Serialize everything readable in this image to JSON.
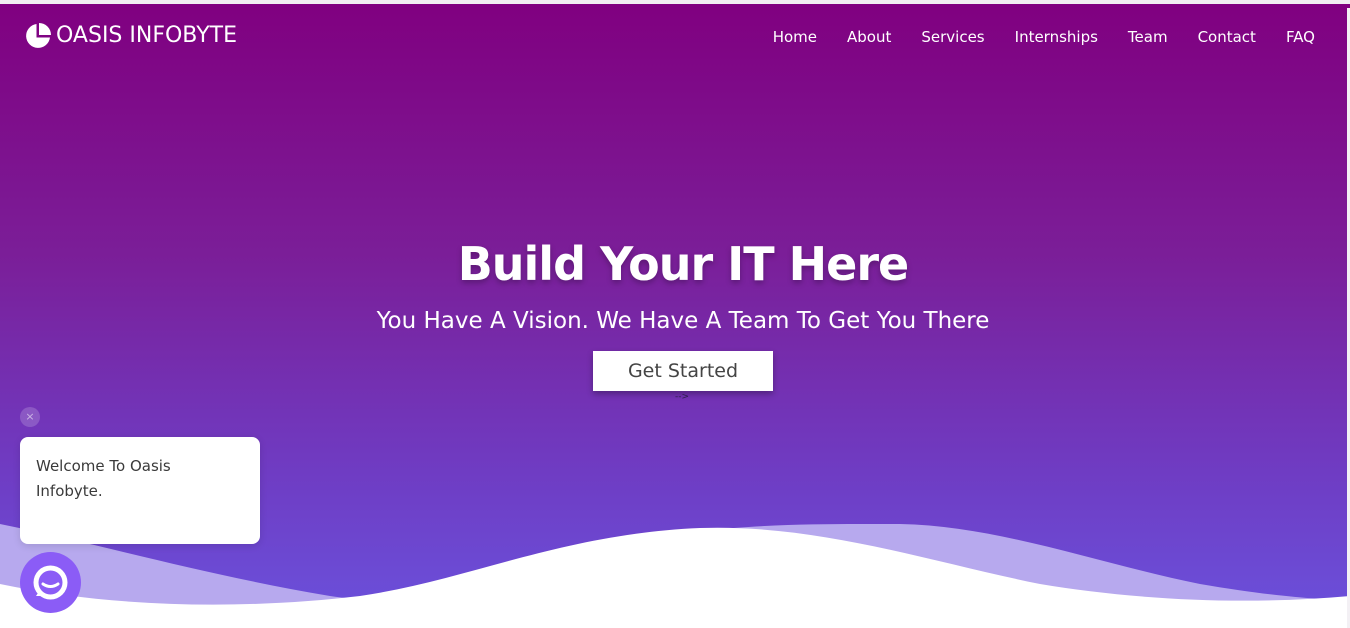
{
  "header": {
    "brand_name": "OASIS INFOBYTE",
    "logo_icon": "pie-chart-icon",
    "nav_items": [
      {
        "label": "Home"
      },
      {
        "label": "About"
      },
      {
        "label": "Services"
      },
      {
        "label": "Internships"
      },
      {
        "label": "Team"
      },
      {
        "label": "Contact"
      },
      {
        "label": "FAQ"
      }
    ]
  },
  "hero": {
    "title": "Build Your IT Here",
    "subtitle": "You Have A Vision. We Have A Team To Get You There",
    "cta_label": "Get Started",
    "stray_text": "-->"
  },
  "chat_widget": {
    "close_symbol": "×",
    "message": "Welcome To Oasis Infobyte.",
    "launcher_icon": "chat-bubble-icon"
  },
  "colors": {
    "hero_top": "#800080",
    "hero_bottom": "#6a52dd",
    "wave_light": "#b7a9ee",
    "launcher": "#8b5cf6"
  }
}
